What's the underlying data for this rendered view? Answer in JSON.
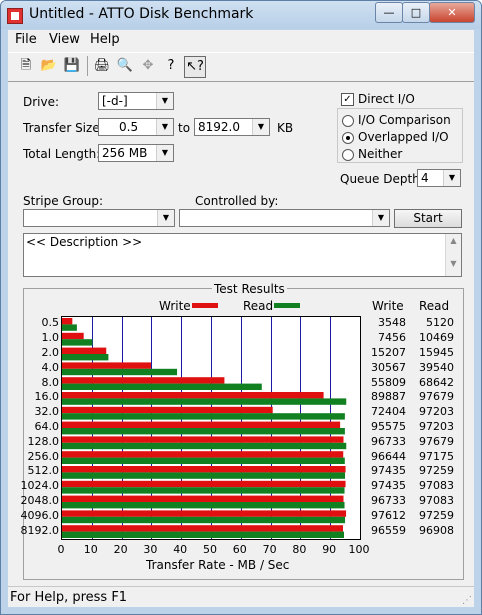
{
  "window": {
    "title": "Untitled - ATTO Disk Benchmark"
  },
  "menu": {
    "file": "File",
    "view": "View",
    "help": "Help"
  },
  "toolbar": {
    "icons": [
      "new-icon",
      "open-icon",
      "save-icon",
      "print-icon",
      "print-preview-icon",
      "move-icon",
      "help-icon",
      "context-help-icon"
    ]
  },
  "form": {
    "drive_label": "Drive:",
    "drive_value": "[-d-]",
    "transfer_size_label": "Transfer Size:",
    "transfer_from": "0.5",
    "to_label": "to",
    "transfer_to": "8192.0",
    "kb_label": "KB",
    "total_length_label": "Total Length:",
    "total_length_value": "256 MB",
    "direct_io_label": "Direct I/O",
    "direct_io_checked": true,
    "io_comparison_label": "I/O Comparison",
    "overlapped_io_label": "Overlapped I/O",
    "neither_label": "Neither",
    "selected_mode": "overlapped",
    "queue_depth_label": "Queue Depth:",
    "queue_depth_value": "4",
    "stripe_group_label": "Stripe Group:",
    "stripe_group_value": "",
    "controlled_by_label": "Controlled by:",
    "controlled_by_value": "",
    "start_label": "Start",
    "description": "<< Description >>"
  },
  "results": {
    "title": "Test Results",
    "legend_write": "Write",
    "legend_read": "Read",
    "col_write": "Write",
    "col_read": "Read",
    "xlabel": "Transfer Rate - MB / Sec"
  },
  "chart_data": {
    "type": "bar",
    "orientation": "horizontal",
    "categories": [
      "0.5",
      "1.0",
      "2.0",
      "4.0",
      "8.0",
      "16.0",
      "32.0",
      "64.0",
      "128.0",
      "256.0",
      "512.0",
      "1024.0",
      "2048.0",
      "4096.0",
      "8192.0"
    ],
    "series": [
      {
        "name": "Write",
        "color": "#e01010",
        "values": [
          3548,
          7456,
          15207,
          30567,
          55809,
          89887,
          72404,
          95575,
          96733,
          96644,
          97435,
          97435,
          96733,
          97612,
          96559
        ]
      },
      {
        "name": "Read",
        "color": "#108020",
        "values": [
          5120,
          10469,
          15945,
          39540,
          68642,
          97679,
          97203,
          97203,
          97679,
          97175,
          97259,
          97083,
          97083,
          97259,
          96908
        ]
      }
    ],
    "xticks": [
      "0",
      "10",
      "20",
      "30",
      "40",
      "50",
      "60",
      "70",
      "80",
      "90",
      "100"
    ],
    "xlim": [
      0,
      100
    ],
    "xlabel": "Transfer Rate - MB / Sec",
    "grid": true
  },
  "status": {
    "text": "For Help, press F1"
  }
}
